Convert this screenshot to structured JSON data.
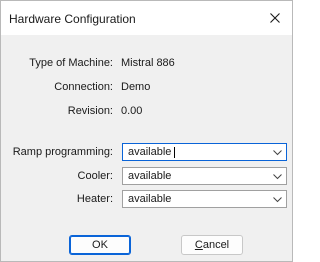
{
  "window": {
    "title": "Hardware Configuration"
  },
  "info": [
    {
      "label": "Type of Machine:",
      "value": "Mistral 886"
    },
    {
      "label": "Connection:",
      "value": "Demo"
    },
    {
      "label": "Revision:",
      "value": "0.00"
    }
  ],
  "fields": [
    {
      "label": "Ramp programming:",
      "value": "available"
    },
    {
      "label": "Cooler:",
      "value": "available"
    },
    {
      "label": "Heater:",
      "value": "available"
    }
  ],
  "buttons": {
    "ok_label": "OK",
    "cancel_first": "C",
    "cancel_rest": "ancel"
  },
  "colors": {
    "accent": "#0a64d8"
  }
}
